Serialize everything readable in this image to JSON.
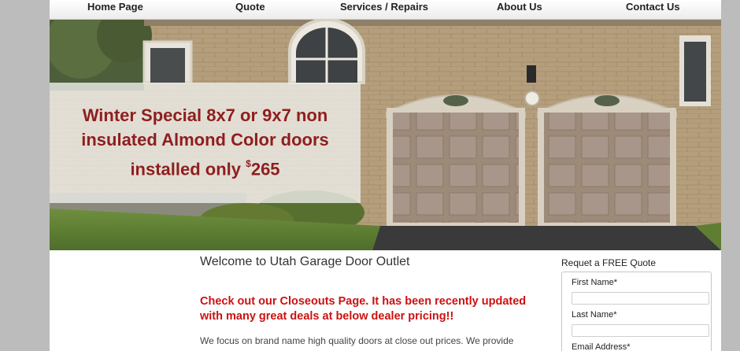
{
  "nav": {
    "items": [
      {
        "label": "Home Page"
      },
      {
        "label": "Quote"
      },
      {
        "label": "Services / Repairs"
      },
      {
        "label": "About Us"
      },
      {
        "label": "Contact Us"
      }
    ]
  },
  "hero": {
    "promo_line1": "Winter Special 8x7 or 9x7 non",
    "promo_line2": "insulated Almond Color doors",
    "promo_line3_prefix": "installed only ",
    "promo_currency": "$",
    "promo_price": "265"
  },
  "main": {
    "title": "Welcome to Utah Garage Door Outlet",
    "closeouts_text": "Check out our Closeouts Page. It has been recently updated with many great deals at below dealer pricing!!",
    "body_text": "We focus on brand name high quality doors at close out prices. We provide"
  },
  "quote_form": {
    "title": "Requet a FREE Quote",
    "first_name_label": "First Name*",
    "last_name_label": "Last Name*",
    "email_label": "Email Address*",
    "first_name_value": "",
    "last_name_value": "",
    "email_value": ""
  },
  "colors": {
    "page_bg": "#bcbcbc",
    "promo_red": "#8f1e1e",
    "closeouts_red": "#cc1111"
  }
}
